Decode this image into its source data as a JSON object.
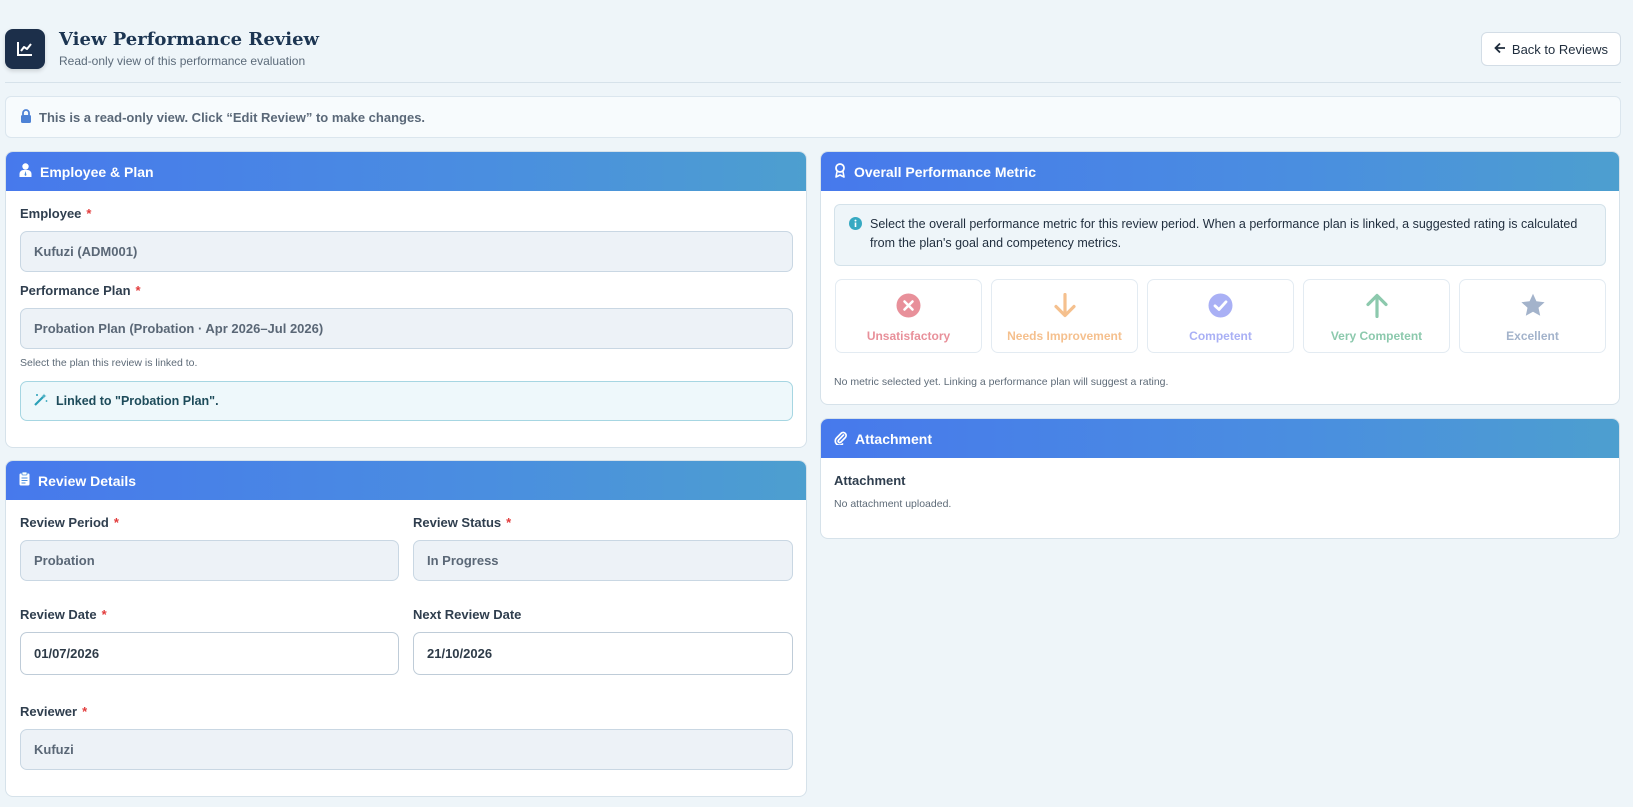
{
  "header": {
    "title": "View Performance Review",
    "subtitle": "Read-only view of this performance evaluation",
    "back_label": "Back to Reviews"
  },
  "banner": {
    "text": "This is a read-only view. Click “Edit Review” to make changes."
  },
  "employee_plan": {
    "title": "Employee & Plan",
    "employee_label": "Employee",
    "employee_value": "Kufuzi (ADM001)",
    "plan_label": "Performance Plan",
    "plan_value": "Probation Plan (Probation · Apr 2026–Jul 2026)",
    "plan_help": "Select the plan this review is linked to.",
    "linked_text": "Linked to \"Probation Plan\"."
  },
  "review_details": {
    "title": "Review Details",
    "period_label": "Review Period",
    "period_value": "Probation",
    "status_label": "Review Status",
    "status_value": "In Progress",
    "date_label": "Review Date",
    "date_value": "01/07/2026",
    "next_date_label": "Next Review Date",
    "next_date_value": "21/10/2026",
    "reviewer_label": "Reviewer",
    "reviewer_value": "Kufuzi"
  },
  "metric": {
    "title": "Overall Performance Metric",
    "info": "Select the overall performance metric for this review period. When a performance plan is linked, a suggested rating is calculated from the plan's goal and competency metrics.",
    "options": [
      {
        "label": "Unsatisfactory",
        "icon": "x-circle-icon",
        "color": "#e8909a"
      },
      {
        "label": "Needs Improvement",
        "icon": "arrow-down-icon",
        "color": "#f5c08e"
      },
      {
        "label": "Competent",
        "icon": "check-circle-icon",
        "color": "#a9b0f5"
      },
      {
        "label": "Very Competent",
        "icon": "arrow-up-icon",
        "color": "#8cc9ad"
      },
      {
        "label": "Excellent",
        "icon": "star-icon",
        "color": "#a3b3cb"
      }
    ],
    "note": "No metric selected yet. Linking a performance plan will suggest a rating."
  },
  "attachment": {
    "title": "Attachment",
    "label": "Attachment",
    "status": "No attachment uploaded."
  },
  "colors": {
    "accent": "#4779ec",
    "required": "#e23b3b",
    "background": "#eef5f9"
  }
}
